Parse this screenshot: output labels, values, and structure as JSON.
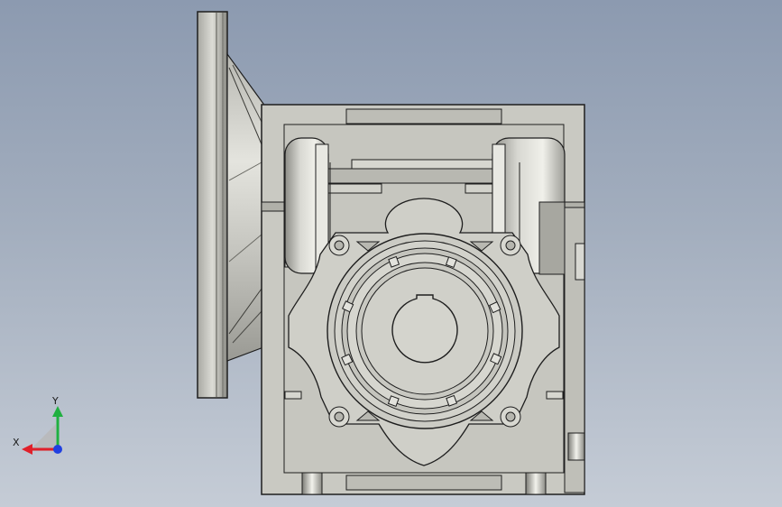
{
  "triad": {
    "x_label": "X",
    "y_label": "Y"
  },
  "colors": {
    "background_top": "#8c9ab0",
    "background_bottom": "#c5ccd6",
    "body": "#c9c9c2",
    "body_shadow": "#9d9d96",
    "edge": "#1e1e1e",
    "x_axis": "#e0202a",
    "y_axis": "#20b040",
    "z_axis": "#2040e0"
  }
}
